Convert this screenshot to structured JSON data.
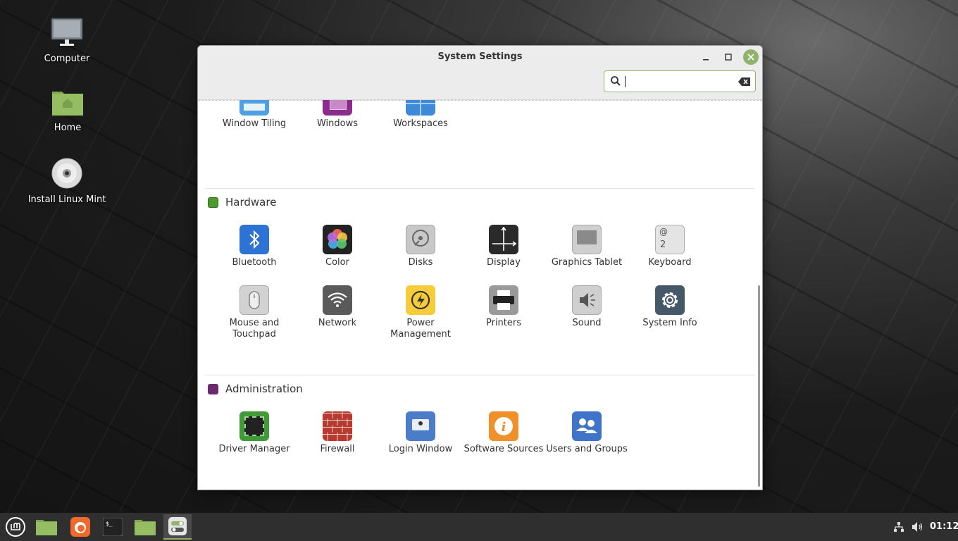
{
  "desktop": {
    "icons": [
      {
        "label": "Computer"
      },
      {
        "label": "Home"
      },
      {
        "label": "Install Linux Mint"
      }
    ]
  },
  "window": {
    "title": "System Settings",
    "search": {
      "value": ""
    }
  },
  "preferences_partial": [
    {
      "label": "Window Tiling"
    },
    {
      "label": "Windows"
    },
    {
      "label": "Workspaces"
    }
  ],
  "hardware": {
    "title": "Hardware",
    "items": [
      {
        "label": "Bluetooth"
      },
      {
        "label": "Color"
      },
      {
        "label": "Disks"
      },
      {
        "label": "Display"
      },
      {
        "label": "Graphics Tablet"
      },
      {
        "label": "Keyboard"
      },
      {
        "label": "Mouse and Touchpad"
      },
      {
        "label": "Network"
      },
      {
        "label": "Power Management"
      },
      {
        "label": "Printers"
      },
      {
        "label": "Sound"
      },
      {
        "label": "System Info"
      }
    ]
  },
  "administration": {
    "title": "Administration",
    "items": [
      {
        "label": "Driver Manager"
      },
      {
        "label": "Firewall"
      },
      {
        "label": "Login Window"
      },
      {
        "label": "Software Sources"
      },
      {
        "label": "Users and Groups"
      }
    ]
  },
  "taskbar": {
    "apps": [
      "menu-icon",
      "files-icon",
      "firefox-icon",
      "terminal-icon",
      "files-icon",
      "settings-icon"
    ],
    "clock": "01:12"
  },
  "colors": {
    "accent": "#8fb36a",
    "taskbar": "#2f2f2f"
  }
}
